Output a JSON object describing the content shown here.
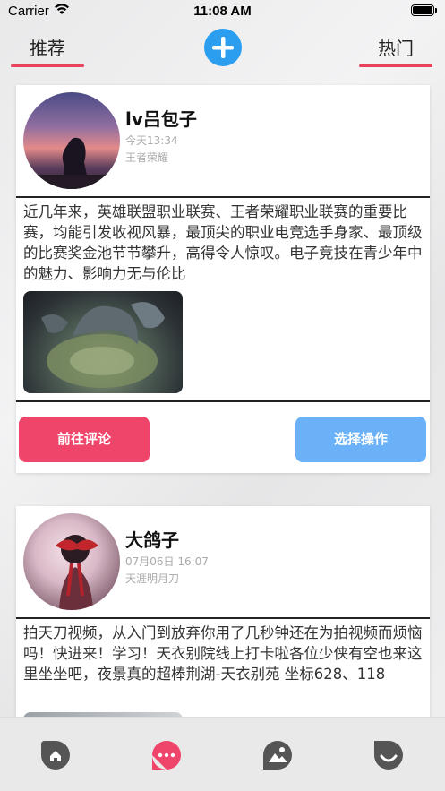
{
  "status_bar": {
    "carrier": "Carrier",
    "time": "11:08 AM"
  },
  "top_nav": {
    "left_tab": "推荐",
    "right_tab": "热门",
    "add_icon": "plus-icon"
  },
  "posts": [
    {
      "name": "lv吕包子",
      "time": "今天13:34",
      "game": "王者荣耀",
      "content": "近几年来，英雄联盟职业联赛、王者荣耀职业联赛的重要比赛，均能引发收视风暴，最顶尖的职业电竞选手身家、最顶级的比赛奖金池节节攀升，高得令人惊叹。电子竞技在青少年中的魅力、影响力无与伦比",
      "comment_button": "前往评论",
      "action_button": "选择操作"
    },
    {
      "name": "大鸽子",
      "time": "07月06日 16:07",
      "game": "天涯明月刀",
      "content": "拍天刀视频，从入门到放弃你用了几秒钟还在为拍视频而烦恼吗！快进来！学习！天衣别院线上打卡啦各位少侠有空也来这里坐坐吧，夜景真的超棒荆湖-天衣别苑 坐标628、118"
    }
  ],
  "tab_bar": {
    "items": [
      {
        "icon": "home-icon"
      },
      {
        "icon": "chat-icon",
        "active_color": "#f0456b"
      },
      {
        "icon": "image-icon"
      },
      {
        "icon": "smile-icon"
      }
    ]
  },
  "colors": {
    "accent": "#e8425c",
    "plus": "#2c9ef0",
    "comment_btn": "#f0456b",
    "action_btn": "#6ab1f7"
  }
}
